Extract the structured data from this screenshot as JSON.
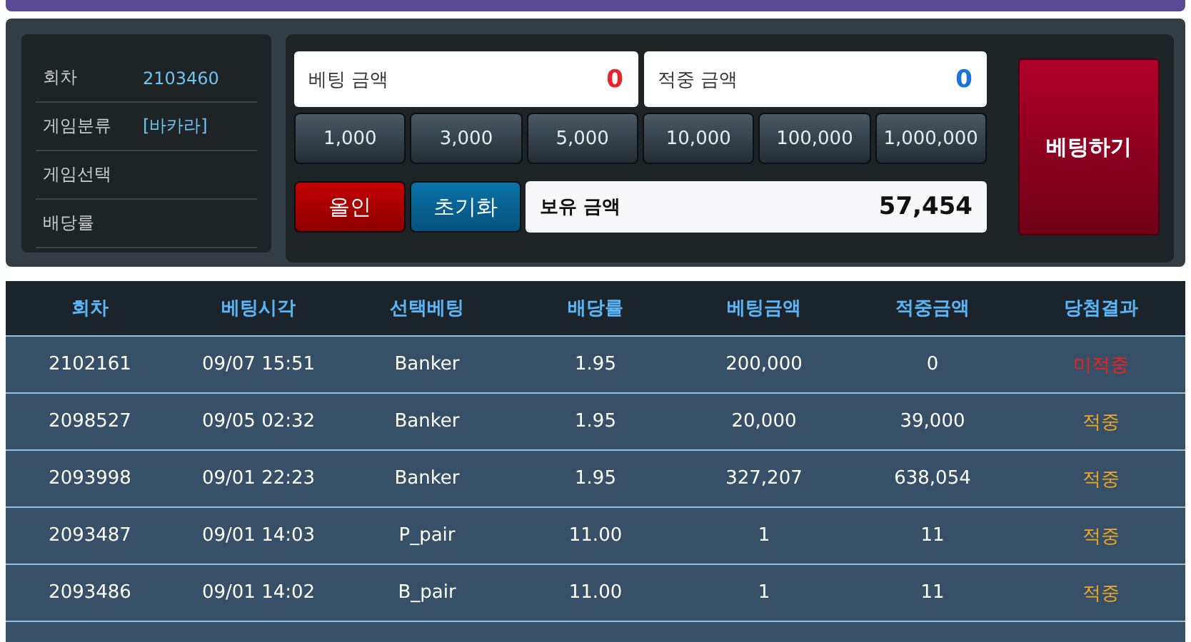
{
  "info": [
    {
      "label": "회차",
      "value": "2103460"
    },
    {
      "label": "게임분류",
      "value": "[바카라]"
    },
    {
      "label": "게임선택"
    },
    {
      "label": "배당률"
    }
  ],
  "bet_amount": {
    "label": "베팅 금액",
    "value": "0"
  },
  "win_amount": {
    "label": "적중 금액",
    "value": "0"
  },
  "chips": [
    "1,000",
    "3,000",
    "5,000",
    "10,000",
    "100,000",
    "1,000,000"
  ],
  "all_in_button": "올인",
  "reset_button": "초기화",
  "balance": {
    "label": "보유 금액",
    "value": "57,454"
  },
  "bet_button": "베팅하기",
  "table": {
    "columns": [
      "회차",
      "베팅시각",
      "선택베팅",
      "배당률",
      "베팅금액",
      "적중금액",
      "당첨결과"
    ],
    "rows": [
      {
        "cells": [
          "2102161",
          "09/07 15:51",
          "Banker",
          "1.95",
          "200,000",
          "0"
        ],
        "result": "미적중",
        "kind": "miss"
      },
      {
        "cells": [
          "2098527",
          "09/05 02:32",
          "Banker",
          "1.95",
          "20,000",
          "39,000"
        ],
        "result": "적중",
        "kind": "hit"
      },
      {
        "cells": [
          "2093998",
          "09/01 22:23",
          "Banker",
          "1.95",
          "327,207",
          "638,054"
        ],
        "result": "적중",
        "kind": "hit"
      },
      {
        "cells": [
          "2093487",
          "09/01 14:03",
          "P_pair",
          "11.00",
          "1",
          "11"
        ],
        "result": "적중",
        "kind": "hit"
      },
      {
        "cells": [
          "2093486",
          "09/01 14:02",
          "B_pair",
          "11.00",
          "1",
          "11"
        ],
        "result": "적중",
        "kind": "hit"
      }
    ]
  }
}
